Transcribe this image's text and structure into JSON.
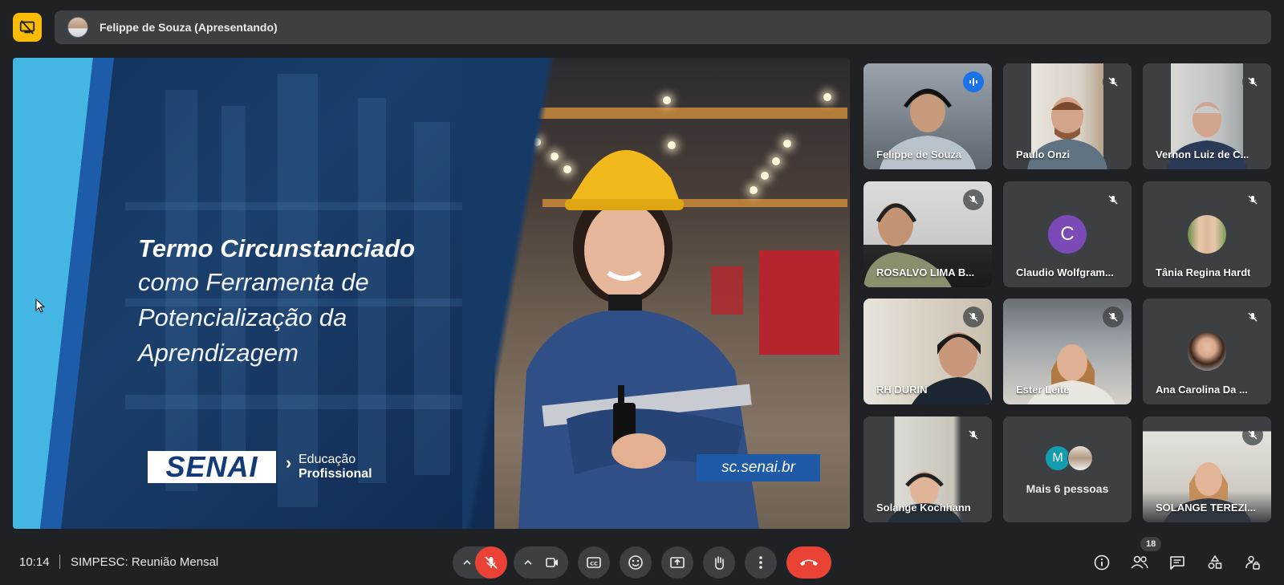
{
  "presenter": {
    "name": "Felippe de Souza (Apresentando)"
  },
  "slide": {
    "title_bold": "Termo Circunstanciado",
    "title_line_1": "como Ferramenta de",
    "title_line_2": "Potencialização da",
    "title_line_3": "Aprendizagem",
    "logo_text": "SENAI",
    "edu_line_1": "Educação",
    "edu_line_2": "Profissional",
    "site": "sc.senai.br"
  },
  "participants": [
    {
      "name": "Felippe de Souza",
      "state": "speaking"
    },
    {
      "name": "Paulo Onzi",
      "state": "muted"
    },
    {
      "name": "Vernon Luiz de C...",
      "state": "muted"
    },
    {
      "name": "ROSALVO LIMA B...",
      "state": "muted"
    },
    {
      "name": "Claudio Wolfgram...",
      "state": "muted",
      "initial": "C"
    },
    {
      "name": "Tânia Regina Hardt",
      "state": "muted"
    },
    {
      "name": "RH DURIN",
      "state": "muted"
    },
    {
      "name": "Ester Leite",
      "state": "muted"
    },
    {
      "name": "Ana Carolina Da ...",
      "state": "muted"
    },
    {
      "name": "Solange Kochhann",
      "state": "muted"
    },
    {
      "name": "Mais 6 pessoas",
      "initial": "M"
    },
    {
      "name": "SOLANGE TEREZI...",
      "state": "muted"
    }
  ],
  "meeting": {
    "time": "10:14",
    "title": "SIMPESC: Reunião Mensal"
  },
  "people_count": "18",
  "colors": {
    "accent": "#8ab4f8",
    "danger": "#ea4335",
    "warning": "#fbbc04",
    "surface": "#3c4043",
    "background": "#202124"
  }
}
